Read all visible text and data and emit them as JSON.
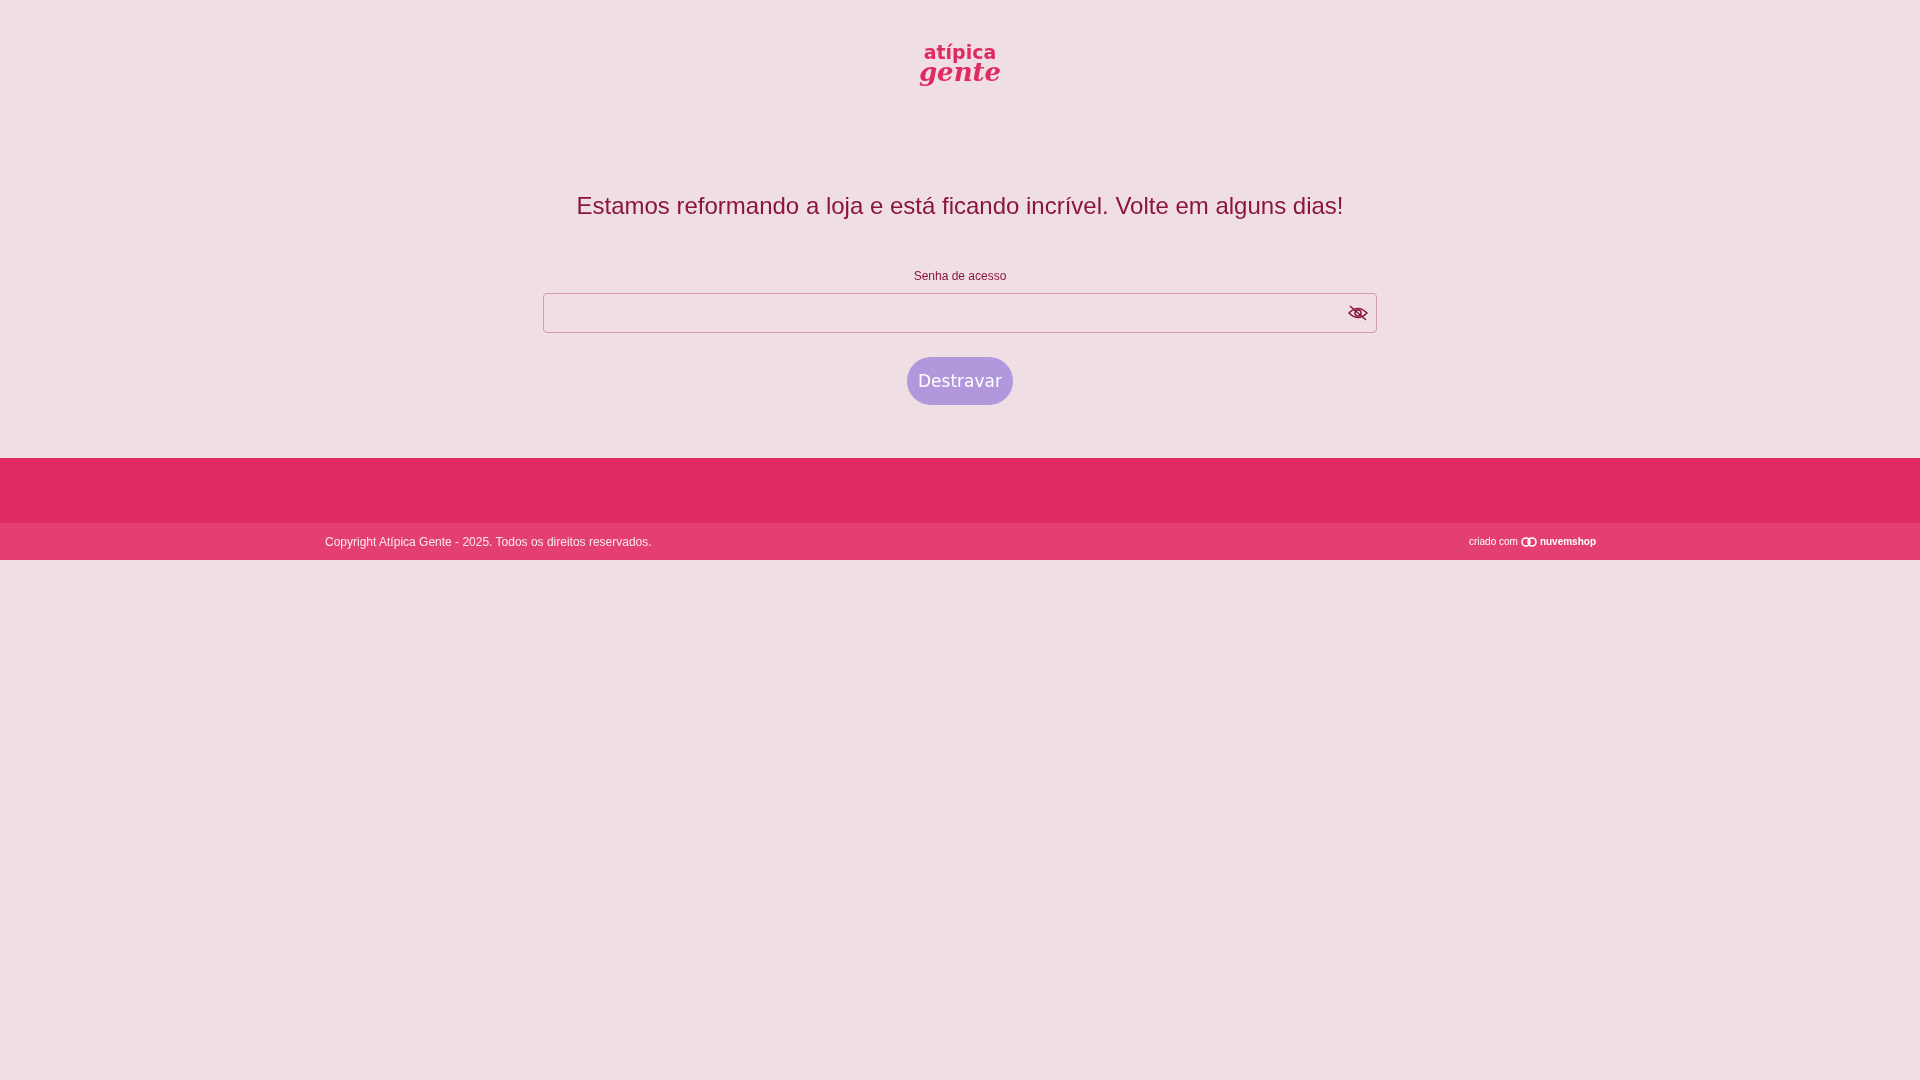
{
  "logo": {
    "line_1": "atípica",
    "line_2": "gente"
  },
  "heading": "Estamos reformando a loja e está ficando incrível. Volte em alguns dias!",
  "password": {
    "label": "Senha de acesso"
  },
  "unlock_button": "Destravar",
  "footer": {
    "copyright": "Copyright Atípica Gente - 2025. Todos os direitos reservados.",
    "credit_prefix": "criado com",
    "credit_brand": "nuvemshop"
  }
}
